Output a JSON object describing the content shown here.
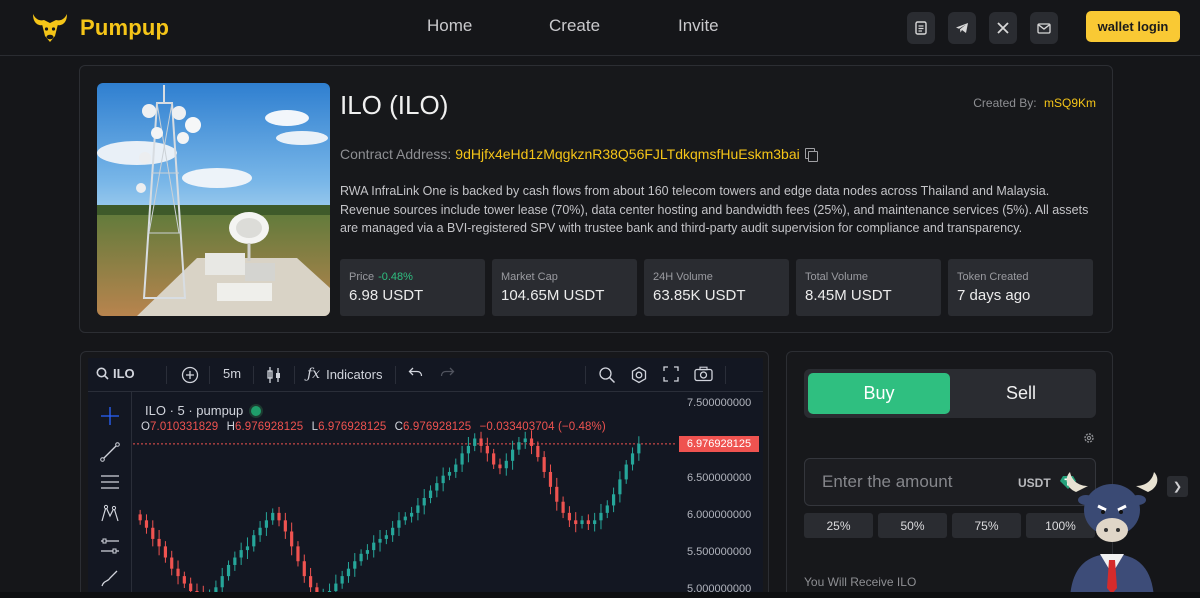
{
  "brand": {
    "name": "Pumpup"
  },
  "nav": {
    "home": "Home",
    "create": "Create",
    "invite": "Invite"
  },
  "header_icons": [
    "document-icon",
    "telegram-icon",
    "x-icon",
    "mail-icon"
  ],
  "wallet": {
    "label": "wallet login"
  },
  "token": {
    "title": "ILO (ILO)",
    "created_by_label": "Created By:",
    "created_by": "mSQ9Km",
    "contract_label": "Contract Address:",
    "contract_address": "9dHjfx4eHd1zMqgkznR38Q56FJLTdkqmsfHuEskm3bai",
    "description": "RWA InfraLink One is backed by cash flows from about 160 telecom towers and edge data nodes across Thailand and Malaysia. Revenue sources include tower lease (70%), data center hosting and bandwidth fees (25%), and maintenance services (5%). All assets are managed via a BVI-registered SPV with trustee bank and third-party audit supervision for compliance and transparency.",
    "stats": [
      {
        "label": "Price",
        "change": "-0.48%",
        "value": "6.98 USDT"
      },
      {
        "label": "Market Cap",
        "value": "104.65M USDT"
      },
      {
        "label": "24H Volume",
        "value": "63.85K USDT"
      },
      {
        "label": "Total Volume",
        "value": "8.45M USDT"
      },
      {
        "label": "Token Created",
        "value": "7 days ago"
      }
    ]
  },
  "chart": {
    "symbol": "ILO",
    "interval": "5m",
    "indicators_label": "Indicators",
    "legend": "ILO · 5 · pumpup",
    "ohlc": {
      "o": "7.010331829",
      "h": "6.976928125",
      "l": "6.976928125",
      "c": "6.976928125",
      "chg": "−0.033403704 (−0.48%)"
    },
    "axis_labels": [
      "7.500000000",
      "6.500000000",
      "6.000000000",
      "5.500000000",
      "5.000000000"
    ],
    "last_price": "6.976928125",
    "colors": {
      "up": "#26a69a",
      "down": "#ef5350"
    }
  },
  "chart_data": {
    "type": "candlestick",
    "ylim": [
      4.9,
      7.65
    ],
    "close_series": [
      5.95,
      5.85,
      5.7,
      5.6,
      5.45,
      5.3,
      5.2,
      5.1,
      5.0,
      4.95,
      4.9,
      4.95,
      5.05,
      5.2,
      5.35,
      5.45,
      5.55,
      5.6,
      5.75,
      5.85,
      5.95,
      6.05,
      5.95,
      5.8,
      5.6,
      5.4,
      5.2,
      5.05,
      4.95,
      4.95,
      5.0,
      5.1,
      5.2,
      5.3,
      5.4,
      5.5,
      5.55,
      5.65,
      5.7,
      5.75,
      5.85,
      5.95,
      6.0,
      6.05,
      6.15,
      6.25,
      6.35,
      6.45,
      6.55,
      6.6,
      6.7,
      6.85,
      6.95,
      7.05,
      6.95,
      6.85,
      6.7,
      6.65,
      6.75,
      6.9,
      7.0,
      7.05,
      6.95,
      6.8,
      6.6,
      6.4,
      6.2,
      6.05,
      5.95,
      5.9,
      5.95,
      5.9,
      5.95,
      6.05,
      6.15,
      6.3,
      6.5,
      6.7,
      6.85,
      6.98
    ]
  },
  "trade": {
    "buy_label": "Buy",
    "sell_label": "Sell",
    "amount_placeholder": "Enter the amount",
    "currency": "USDT",
    "percents": [
      "25%",
      "50%",
      "75%",
      "100%"
    ],
    "receive_label": "You Will Receive ILO"
  }
}
